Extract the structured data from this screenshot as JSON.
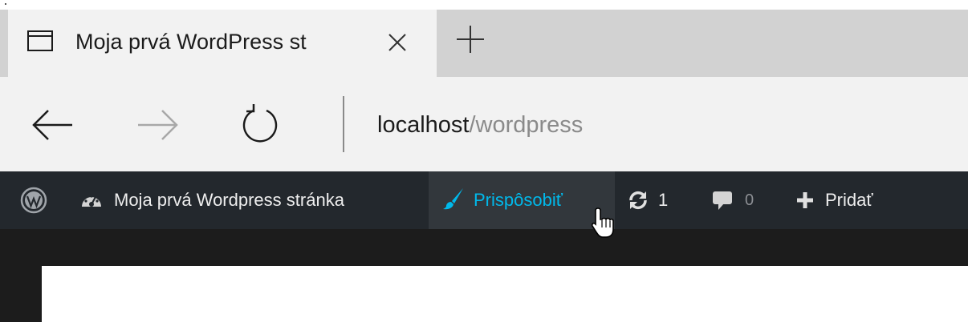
{
  "browser": {
    "tab": {
      "title": "Moja prvá WordPress st",
      "icon": "page-icon",
      "close_icon": "close-icon"
    },
    "new_tab_icon": "plus-icon",
    "nav": {
      "back_icon": "arrow-left-icon",
      "forward_icon": "arrow-right-icon",
      "refresh_icon": "refresh-icon"
    },
    "address": {
      "host": "localhost",
      "path": "/wordpress"
    }
  },
  "adminbar": {
    "wp_icon": "wordpress-logo-icon",
    "site_name": "Moja prvá Wordpress stránka",
    "site_icon": "dashboard-icon",
    "customize_label": "Prispôsobiť",
    "customize_icon": "paintbrush-icon",
    "updates_count": "1",
    "updates_icon": "updates-icon",
    "comments_count": "0",
    "comments_icon": "comment-icon",
    "new_label": "Pridať",
    "new_icon": "plus-icon"
  },
  "colors": {
    "adminbar_bg": "#23282d",
    "adminbar_hover_bg": "#32373c",
    "accent": "#00b9eb",
    "tabstrip_bg": "#d2d2d2",
    "chrome_bg": "#f2f2f2"
  }
}
